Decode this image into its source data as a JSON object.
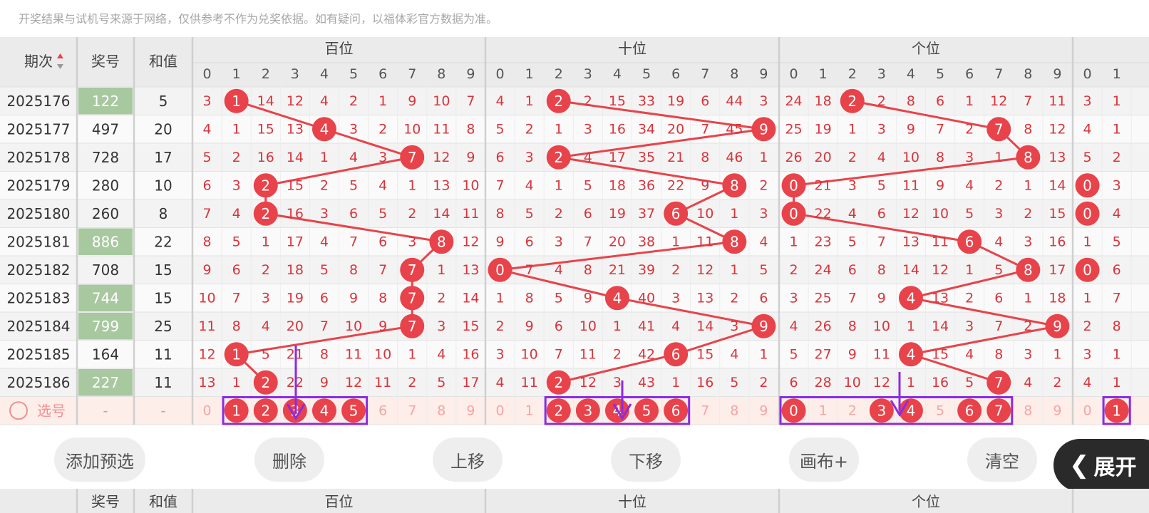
{
  "notice": "开奖结果与试机号来源于网络，仅供参考不作为兑奖依据。如有疑问，以福体彩官方数据为准。",
  "table": {
    "headers": {
      "issue": "期次",
      "sort_icon": "sort-up-down-icon",
      "number": "奖号",
      "sum": "和值"
    },
    "groups": [
      "百位",
      "十位",
      "个位"
    ],
    "digits": [
      "0",
      "1",
      "2",
      "3",
      "4",
      "5",
      "6",
      "7",
      "8",
      "9"
    ],
    "rows": [
      {
        "issue": "2025176",
        "number": "122",
        "sum": "5",
        "highlight": true,
        "hundreds": [
          "3",
          "1",
          "14",
          "12",
          "4",
          "2",
          "1",
          "9",
          "10",
          "7"
        ],
        "tens": [
          "4",
          "1",
          "2",
          "2",
          "15",
          "33",
          "19",
          "6",
          "44",
          "3"
        ],
        "ones": [
          "24",
          "18",
          "2",
          "2",
          "8",
          "6",
          "1",
          "12",
          "7",
          "11"
        ],
        "extra": [
          "3",
          "1"
        ]
      },
      {
        "issue": "2025177",
        "number": "497",
        "sum": "20",
        "highlight": false,
        "hundreds": [
          "4",
          "1",
          "15",
          "13",
          "4",
          "3",
          "2",
          "10",
          "11",
          "8"
        ],
        "tens": [
          "5",
          "2",
          "1",
          "3",
          "16",
          "34",
          "20",
          "7",
          "45",
          "9"
        ],
        "ones": [
          "25",
          "19",
          "1",
          "3",
          "9",
          "7",
          "2",
          "7",
          "8",
          "12"
        ],
        "extra": [
          "4",
          "1"
        ]
      },
      {
        "issue": "2025178",
        "number": "728",
        "sum": "17",
        "highlight": false,
        "hundreds": [
          "5",
          "2",
          "16",
          "14",
          "1",
          "4",
          "3",
          "7",
          "12",
          "9"
        ],
        "tens": [
          "6",
          "3",
          "2",
          "4",
          "17",
          "35",
          "21",
          "8",
          "46",
          "1"
        ],
        "ones": [
          "26",
          "20",
          "2",
          "4",
          "10",
          "8",
          "3",
          "1",
          "8",
          "13"
        ],
        "extra": [
          "5",
          "2"
        ]
      },
      {
        "issue": "2025179",
        "number": "280",
        "sum": "10",
        "highlight": false,
        "hundreds": [
          "6",
          "3",
          "2",
          "15",
          "2",
          "5",
          "4",
          "1",
          "13",
          "10"
        ],
        "tens": [
          "7",
          "4",
          "1",
          "5",
          "18",
          "36",
          "22",
          "9",
          "8",
          "2"
        ],
        "ones": [
          "0",
          "21",
          "3",
          "5",
          "11",
          "9",
          "4",
          "2",
          "1",
          "14"
        ],
        "extra": [
          "0",
          "3"
        ]
      },
      {
        "issue": "2025180",
        "number": "260",
        "sum": "8",
        "highlight": false,
        "hundreds": [
          "7",
          "4",
          "2",
          "16",
          "3",
          "6",
          "5",
          "2",
          "14",
          "11"
        ],
        "tens": [
          "8",
          "5",
          "2",
          "6",
          "19",
          "37",
          "6",
          "10",
          "1",
          "3"
        ],
        "ones": [
          "0",
          "22",
          "4",
          "6",
          "12",
          "10",
          "5",
          "3",
          "2",
          "15"
        ],
        "extra": [
          "0",
          "4"
        ]
      },
      {
        "issue": "2025181",
        "number": "886",
        "sum": "22",
        "highlight": true,
        "hundreds": [
          "8",
          "5",
          "1",
          "17",
          "4",
          "7",
          "6",
          "3",
          "8",
          "12"
        ],
        "tens": [
          "9",
          "6",
          "3",
          "7",
          "20",
          "38",
          "1",
          "11",
          "8",
          "4"
        ],
        "ones": [
          "1",
          "23",
          "5",
          "7",
          "13",
          "11",
          "6",
          "4",
          "3",
          "16"
        ],
        "extra": [
          "1",
          "5"
        ]
      },
      {
        "issue": "2025182",
        "number": "708",
        "sum": "15",
        "highlight": false,
        "hundreds": [
          "9",
          "6",
          "2",
          "18",
          "5",
          "8",
          "7",
          "7",
          "1",
          "13"
        ],
        "tens": [
          "0",
          "7",
          "4",
          "8",
          "21",
          "39",
          "2",
          "12",
          "1",
          "5"
        ],
        "ones": [
          "2",
          "24",
          "6",
          "8",
          "14",
          "12",
          "1",
          "5",
          "8",
          "17"
        ],
        "extra": [
          "0",
          "6"
        ]
      },
      {
        "issue": "2025183",
        "number": "744",
        "sum": "15",
        "highlight": true,
        "hundreds": [
          "10",
          "7",
          "3",
          "19",
          "6",
          "9",
          "8",
          "7",
          "2",
          "14"
        ],
        "tens": [
          "1",
          "8",
          "5",
          "9",
          "4",
          "40",
          "3",
          "13",
          "2",
          "6"
        ],
        "ones": [
          "3",
          "25",
          "7",
          "9",
          "4",
          "13",
          "2",
          "6",
          "1",
          "18"
        ],
        "extra": [
          "1",
          "7"
        ]
      },
      {
        "issue": "2025184",
        "number": "799",
        "sum": "25",
        "highlight": true,
        "hundreds": [
          "11",
          "8",
          "4",
          "20",
          "7",
          "10",
          "9",
          "7",
          "3",
          "15"
        ],
        "tens": [
          "2",
          "9",
          "6",
          "10",
          "1",
          "41",
          "4",
          "14",
          "3",
          "9"
        ],
        "ones": [
          "4",
          "26",
          "8",
          "10",
          "1",
          "14",
          "3",
          "7",
          "2",
          "9"
        ],
        "extra": [
          "2",
          "8"
        ]
      },
      {
        "issue": "2025185",
        "number": "164",
        "sum": "11",
        "highlight": false,
        "hundreds": [
          "12",
          "1",
          "5",
          "21",
          "8",
          "11",
          "10",
          "1",
          "4",
          "16"
        ],
        "tens": [
          "3",
          "10",
          "7",
          "11",
          "2",
          "42",
          "6",
          "15",
          "4",
          "1"
        ],
        "ones": [
          "5",
          "27",
          "9",
          "11",
          "4",
          "15",
          "4",
          "8",
          "3",
          "1"
        ],
        "extra": [
          "3",
          "1"
        ]
      },
      {
        "issue": "2025186",
        "number": "227",
        "sum": "11",
        "highlight": true,
        "hundreds": [
          "13",
          "1",
          "2",
          "22",
          "9",
          "12",
          "11",
          "2",
          "5",
          "17"
        ],
        "tens": [
          "4",
          "11",
          "2",
          "12",
          "3",
          "43",
          "1",
          "16",
          "5",
          "2"
        ],
        "ones": [
          "6",
          "28",
          "10",
          "12",
          "1",
          "16",
          "5",
          "7",
          "4",
          "2"
        ],
        "extra": [
          "4",
          "1"
        ]
      }
    ],
    "select_row": {
      "label": "选号",
      "number": "-",
      "sum": "-",
      "selected": {
        "hundreds": [
          "1",
          "2",
          "3",
          "4",
          "5"
        ],
        "tens": [
          "2",
          "3",
          "4",
          "5",
          "6"
        ],
        "ones": [
          "0",
          "3",
          "4",
          "6",
          "7"
        ],
        "extra": [
          "1"
        ]
      }
    }
  },
  "buttons": [
    "添加预选",
    "删除",
    "上移",
    "下移",
    "画布+",
    "清空"
  ],
  "expand_button": "展开",
  "expand_icon": "chevron-left-icon",
  "second_table": {
    "number": "奖号",
    "sum": "和值",
    "groups": [
      "百位",
      "十位",
      "个位"
    ]
  },
  "colors": {
    "red": "#e8434a",
    "green_cell": "#a8c8a0",
    "purple": "#8b2be2",
    "select_row_bg": "#fdeeea",
    "header_bg": "#ebebeb"
  }
}
